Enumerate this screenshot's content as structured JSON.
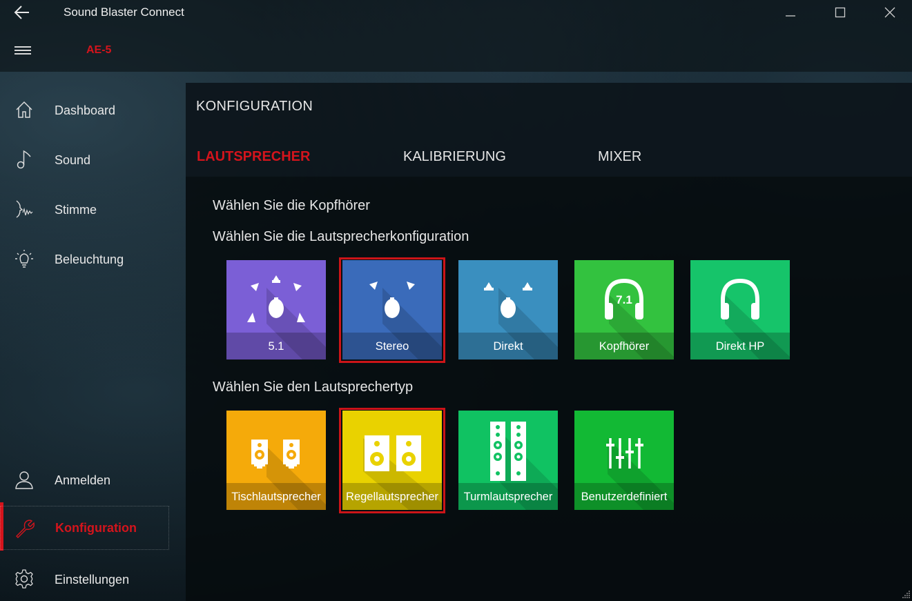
{
  "window": {
    "title": "Sound Blaster Connect",
    "device": "AE-5"
  },
  "sidebar": {
    "items": [
      {
        "label": "Dashboard",
        "icon": "home-icon"
      },
      {
        "label": "Sound",
        "icon": "music-note-icon"
      },
      {
        "label": "Stimme",
        "icon": "voice-icon"
      },
      {
        "label": "Beleuchtung",
        "icon": "lightbulb-icon"
      }
    ],
    "bottom_items": [
      {
        "label": "Anmelden",
        "icon": "user-icon"
      },
      {
        "label": "Konfiguration",
        "icon": "wrench-icon",
        "active": true
      },
      {
        "label": "Einstellungen",
        "icon": "gear-icon"
      }
    ]
  },
  "page": {
    "title": "KONFIGURATION",
    "tabs": [
      {
        "label": "LAUTSPRECHER",
        "active": true
      },
      {
        "label": "KALIBRIERUNG",
        "active": false
      },
      {
        "label": "MIXER",
        "active": false
      }
    ]
  },
  "sections": {
    "headphones_label": "Wählen Sie die Kopfhörer",
    "config_label": "Wählen Sie die Lautsprecherkonfiguration",
    "type_label": "Wählen Sie den Lautsprechertyp"
  },
  "config_tiles": [
    {
      "label": "5.1",
      "color": "#7b5fd6",
      "icon": "surround-5-1-icon",
      "selected": false
    },
    {
      "label": "Stereo",
      "color": "#3a6bba",
      "icon": "stereo-icon",
      "selected": true
    },
    {
      "label": "Direkt",
      "color": "#3a8fbf",
      "icon": "direct-icon",
      "selected": false
    },
    {
      "label": "Kopfhörer",
      "color": "#33c23f",
      "icon": "headphones-7-1-icon",
      "selected": false
    },
    {
      "label": "Direkt HP",
      "color": "#16c46a",
      "icon": "headphones-icon",
      "selected": false
    }
  ],
  "type_tiles": [
    {
      "label": "Tischlautsprecher",
      "color": "#f5aa0a",
      "icon": "desktop-speaker-icon",
      "selected": false
    },
    {
      "label": "Regellautsprecher",
      "color": "#e9d200",
      "icon": "bookshelf-speaker-icon",
      "selected": true
    },
    {
      "label": "Turmlautsprecher",
      "color": "#10c262",
      "icon": "tower-speaker-icon",
      "selected": false
    },
    {
      "label": "Benutzerdefiniert",
      "color": "#12b934",
      "icon": "custom-sliders-icon",
      "selected": false
    }
  ],
  "colors": {
    "accent": "#d4141c",
    "selection_frame": "#cc1418"
  }
}
